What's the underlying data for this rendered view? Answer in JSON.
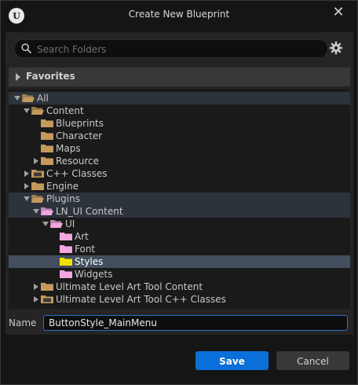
{
  "window": {
    "title": "Create New Blueprint",
    "close_glyph": "✕",
    "logo_glyph": "U"
  },
  "search": {
    "placeholder": "Search Folders"
  },
  "favorites": {
    "label": "Favorites"
  },
  "tree": [
    {
      "label": "All",
      "depth": 0,
      "arrow": "expanded",
      "folder": "open",
      "color": "#c49a5c",
      "highlight": true
    },
    {
      "label": "Content",
      "depth": 1,
      "arrow": "expanded",
      "folder": "open",
      "color": "#c49a5c"
    },
    {
      "label": "Blueprints",
      "depth": 2,
      "arrow": "none",
      "folder": "closed",
      "color": "#c49a5c"
    },
    {
      "label": "Character",
      "depth": 2,
      "arrow": "none",
      "folder": "closed",
      "color": "#c49a5c"
    },
    {
      "label": "Maps",
      "depth": 2,
      "arrow": "none",
      "folder": "closed",
      "color": "#c49a5c"
    },
    {
      "label": "Resource",
      "depth": 2,
      "arrow": "collapsed",
      "folder": "closed",
      "color": "#c49a5c"
    },
    {
      "label": "C++ Classes",
      "depth": 1,
      "arrow": "collapsed",
      "folder": "code",
      "color": "#c49a5c"
    },
    {
      "label": "Engine",
      "depth": 1,
      "arrow": "collapsed",
      "folder": "closed",
      "color": "#c49a5c"
    },
    {
      "label": "Plugins",
      "depth": 1,
      "arrow": "expanded",
      "folder": "open",
      "color": "#c49a5c",
      "highlight": true
    },
    {
      "label": "LN_UI Content",
      "depth": 2,
      "arrow": "expanded",
      "folder": "open",
      "color": "#f2a6e0",
      "highlight": true
    },
    {
      "label": "UI",
      "depth": 3,
      "arrow": "expanded",
      "folder": "open",
      "color": "#f2a6e0"
    },
    {
      "label": "Art",
      "depth": 4,
      "arrow": "none",
      "folder": "closed",
      "color": "#f2a6e0"
    },
    {
      "label": "Font",
      "depth": 4,
      "arrow": "none",
      "folder": "closed",
      "color": "#f2a6e0"
    },
    {
      "label": "Styles",
      "depth": 4,
      "arrow": "none",
      "folder": "closed",
      "color": "#f0e000",
      "selected": true
    },
    {
      "label": "Widgets",
      "depth": 4,
      "arrow": "none",
      "folder": "closed",
      "color": "#f2a6e0"
    },
    {
      "label": "Ultimate Level Art Tool Content",
      "depth": 2,
      "arrow": "collapsed",
      "folder": "closed",
      "color": "#c49a5c"
    },
    {
      "label": "Ultimate Level Art Tool C++ Classes",
      "depth": 2,
      "arrow": "collapsed",
      "folder": "code",
      "color": "#c49a5c"
    }
  ],
  "name_field": {
    "label": "Name",
    "value": "ButtonStyle_MainMenu"
  },
  "buttons": {
    "save": "Save",
    "cancel": "Cancel"
  },
  "colors": {
    "accent": "#0a6fd8",
    "selection": "#434f5e",
    "highlight": "#2c333b"
  }
}
